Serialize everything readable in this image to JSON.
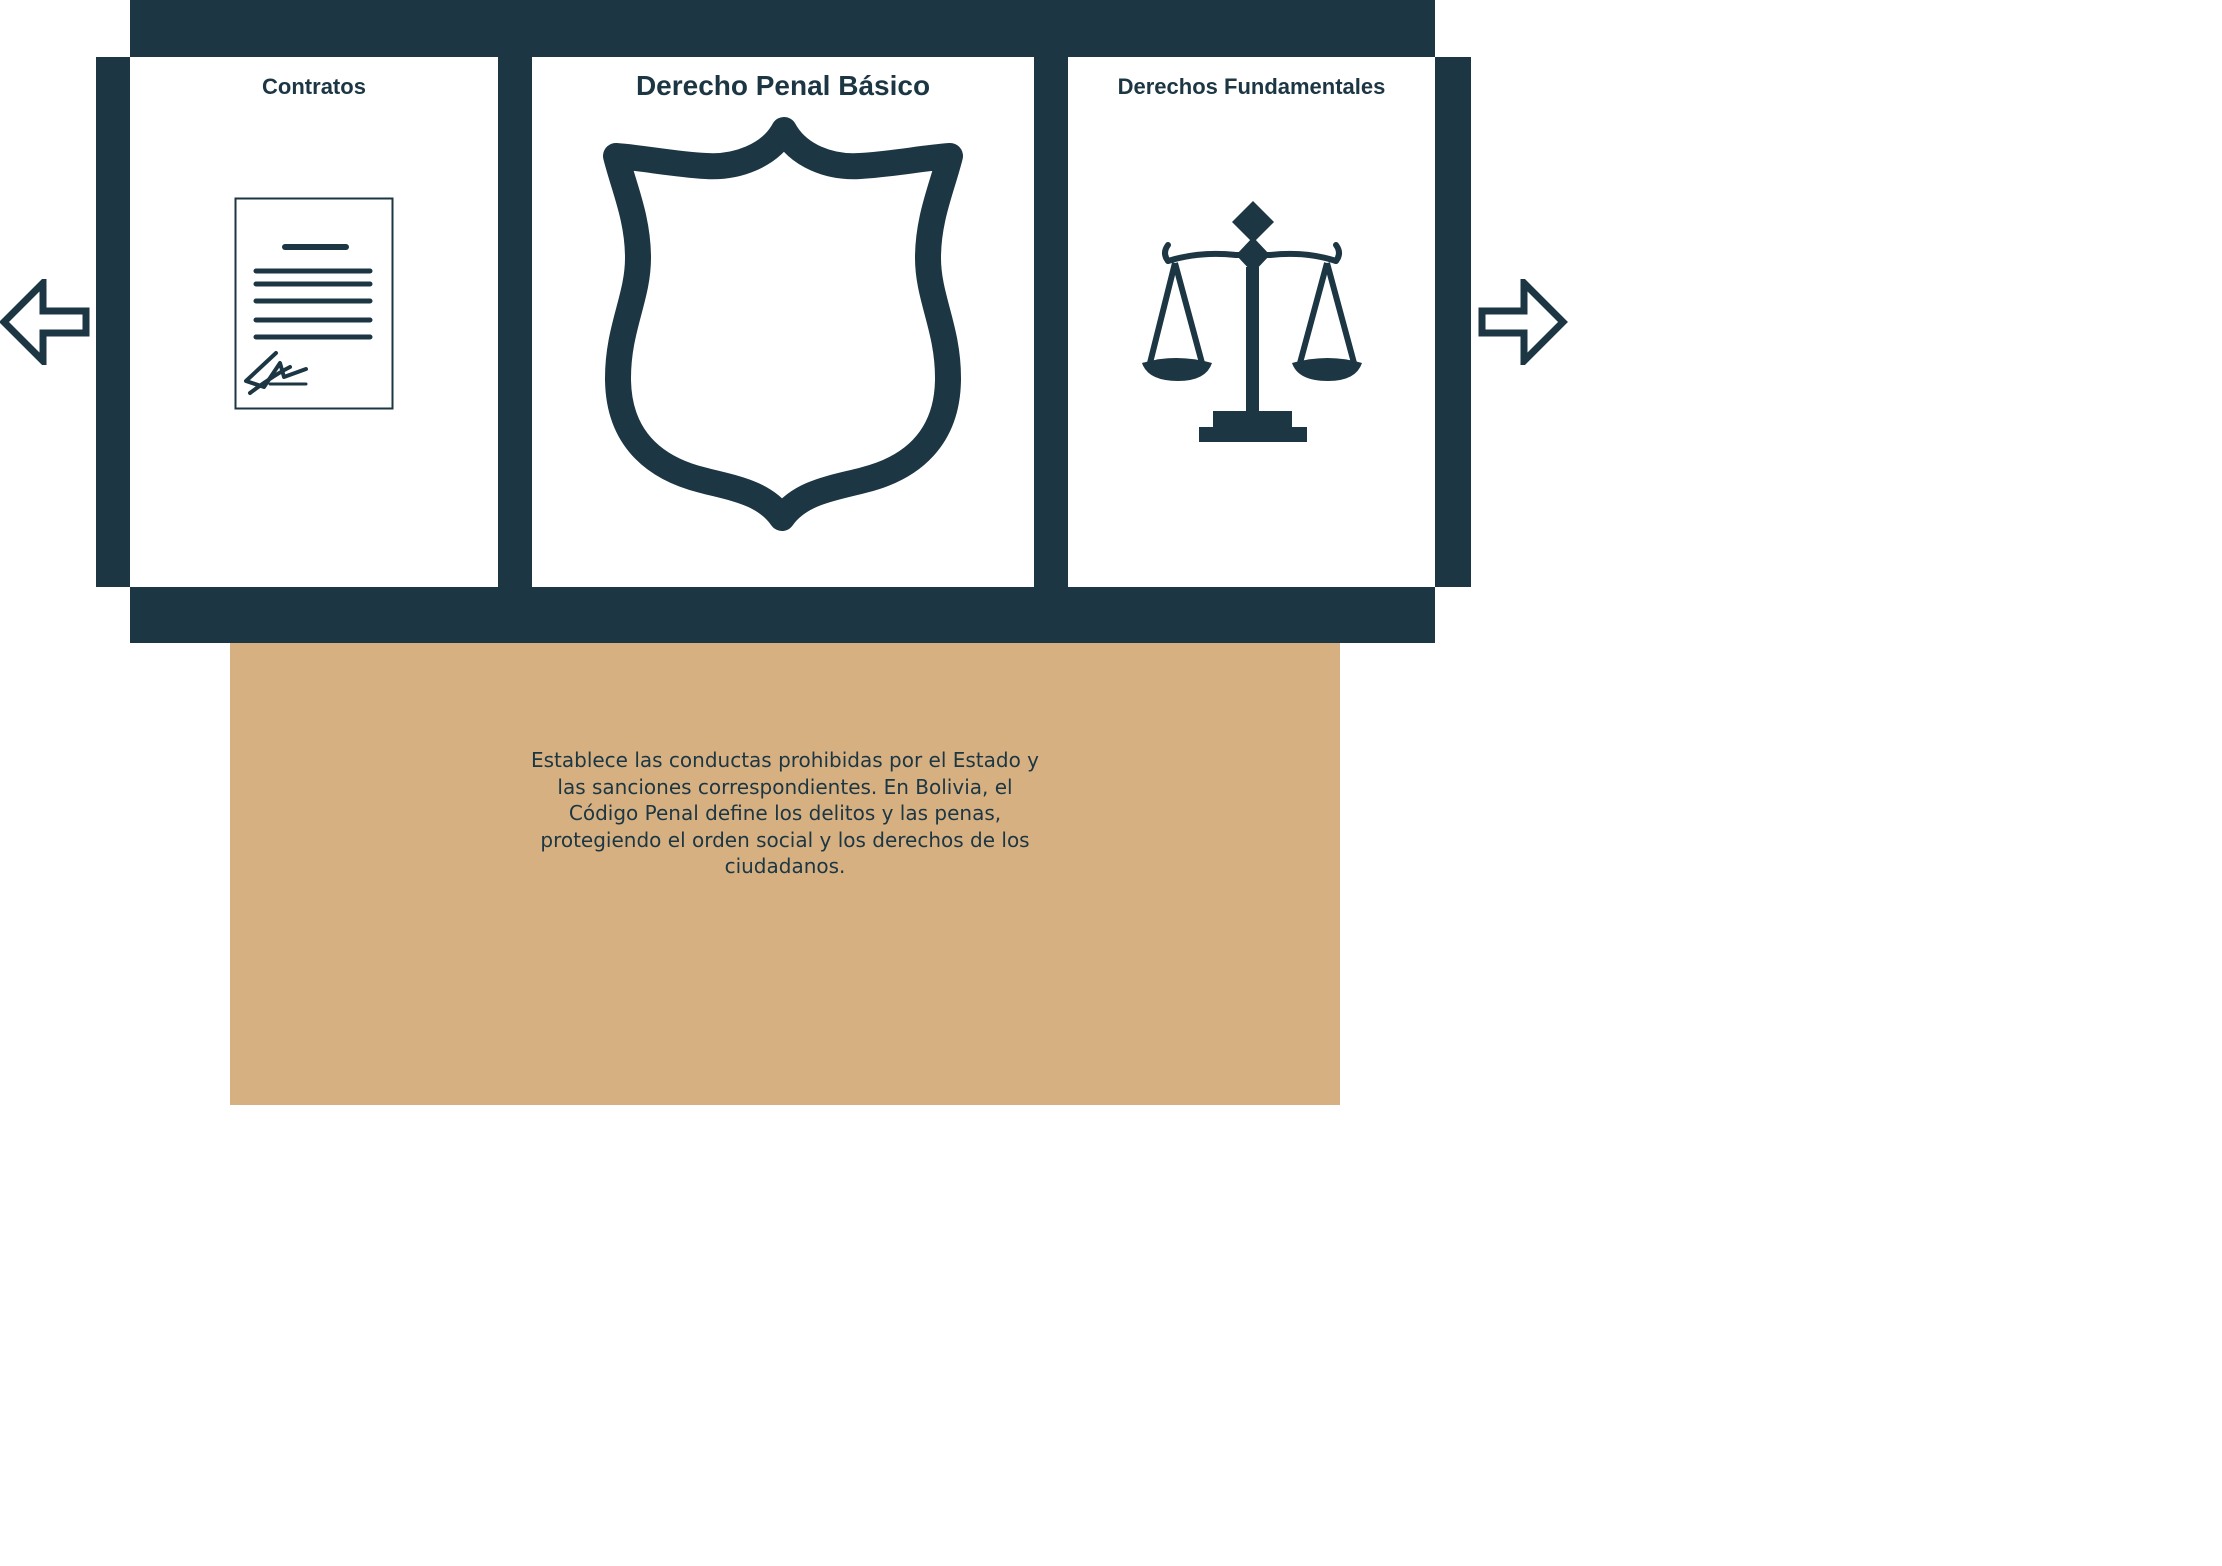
{
  "colors": {
    "frame": "#1c3643",
    "card_background": "#ffffff",
    "panel": "#d6b081",
    "text": "#1c3643"
  },
  "carousel": {
    "previous_icon": "arrow-left-icon",
    "next_icon": "arrow-right-icon",
    "cards": [
      {
        "title": "Contratos",
        "icon": "signed-document-icon"
      },
      {
        "title": "Derecho Penal Básico",
        "icon": "shield-icon"
      },
      {
        "title": "Derechos Fundamentales",
        "icon": "scales-of-justice-icon"
      }
    ]
  },
  "description": {
    "text": "Establece las conductas prohibidas por el Estado y las sanciones correspondientes. En Bolivia, el Código Penal define los delitos y las penas, protegiendo el orden social y los derechos de los ciudadanos."
  }
}
